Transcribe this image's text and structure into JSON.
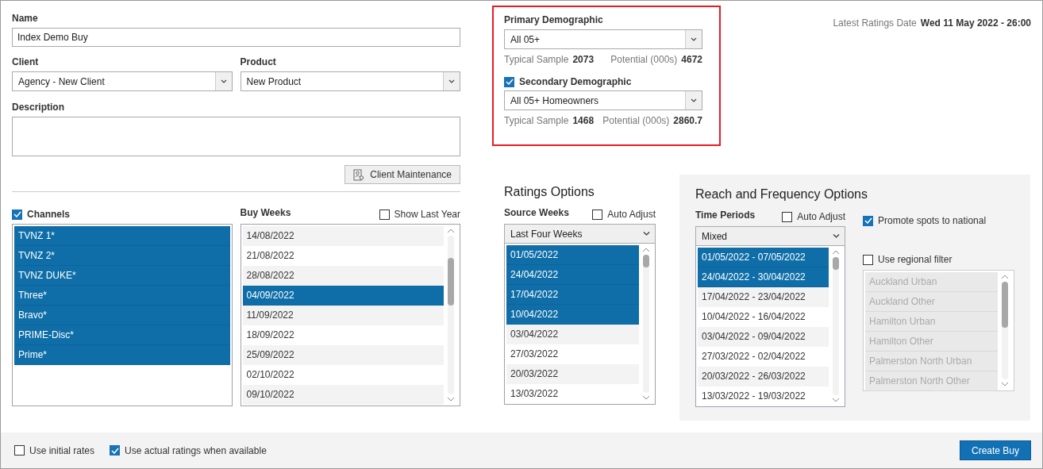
{
  "name": {
    "label": "Name",
    "value": "Index Demo Buy"
  },
  "client": {
    "label": "Client",
    "value": "Agency - New Client"
  },
  "product": {
    "label": "Product",
    "value": "New Product"
  },
  "description": {
    "label": "Description"
  },
  "client_maintenance_button": "Client Maintenance",
  "primary_demographic": {
    "label": "Primary Demographic",
    "value": "All 05+",
    "typical_sample_label": "Typical Sample",
    "typical_sample": "2073",
    "potential_label": "Potential (000s)",
    "potential": "4672"
  },
  "secondary_demographic": {
    "label": "Secondary Demographic",
    "checked": true,
    "value": "All 05+ Homeowners",
    "typical_sample_label": "Typical Sample",
    "typical_sample": "1468",
    "potential_label": "Potential (000s)",
    "potential": "2860.7"
  },
  "latest_ratings": {
    "label": "Latest Ratings Date",
    "value": "Wed 11 May 2022 - 26:00"
  },
  "channels": {
    "label": "Channels",
    "checked": true,
    "items": [
      {
        "label": "TVNZ 1*",
        "selected": true
      },
      {
        "label": "TVNZ 2*",
        "selected": true
      },
      {
        "label": "TVNZ DUKE*",
        "selected": true
      },
      {
        "label": "Three*",
        "selected": true
      },
      {
        "label": "Bravo*",
        "selected": true
      },
      {
        "label": "PRIME-Disc*",
        "selected": true
      },
      {
        "label": "Prime*",
        "selected": true
      }
    ]
  },
  "buy_weeks": {
    "label": "Buy Weeks",
    "show_last_year": {
      "label": "Show Last Year",
      "checked": false
    },
    "items": [
      {
        "label": "14/08/2022",
        "selected": false
      },
      {
        "label": "21/08/2022",
        "selected": false
      },
      {
        "label": "28/08/2022",
        "selected": false
      },
      {
        "label": "04/09/2022",
        "selected": true
      },
      {
        "label": "11/09/2022",
        "selected": false
      },
      {
        "label": "18/09/2022",
        "selected": false
      },
      {
        "label": "25/09/2022",
        "selected": false
      },
      {
        "label": "02/10/2022",
        "selected": false
      },
      {
        "label": "09/10/2022",
        "selected": false
      }
    ]
  },
  "ratings_options": {
    "title": "Ratings Options",
    "source_weeks_label": "Source Weeks",
    "auto_adjust": {
      "label": "Auto Adjust",
      "checked": false
    },
    "dropdown": "Last Four Weeks",
    "items": [
      {
        "label": "01/05/2022",
        "selected": true
      },
      {
        "label": "24/04/2022",
        "selected": true
      },
      {
        "label": "17/04/2022",
        "selected": true
      },
      {
        "label": "10/04/2022",
        "selected": true
      },
      {
        "label": "03/04/2022",
        "selected": false
      },
      {
        "label": "27/03/2022",
        "selected": false
      },
      {
        "label": "20/03/2022",
        "selected": false
      },
      {
        "label": "13/03/2022",
        "selected": false
      }
    ]
  },
  "reach_frequency": {
    "title": "Reach and Frequency Options",
    "time_periods_label": "Time Periods",
    "auto_adjust": {
      "label": "Auto Adjust",
      "checked": false
    },
    "dropdown": "Mixed",
    "items": [
      {
        "label": "01/05/2022 - 07/05/2022",
        "selected": true
      },
      {
        "label": "24/04/2022 - 30/04/2022",
        "selected": true
      },
      {
        "label": "17/04/2022 - 23/04/2022",
        "selected": false
      },
      {
        "label": "10/04/2022 - 16/04/2022",
        "selected": false
      },
      {
        "label": "03/04/2022 - 09/04/2022",
        "selected": false
      },
      {
        "label": "27/03/2022 - 02/04/2022",
        "selected": false
      },
      {
        "label": "20/03/2022 - 26/03/2022",
        "selected": false
      },
      {
        "label": "13/03/2022 - 19/03/2022",
        "selected": false
      }
    ],
    "promote_spots": {
      "label": "Promote spots to national",
      "checked": true
    },
    "regional_filter": {
      "label": "Use regional filter",
      "checked": false
    },
    "regions": [
      {
        "label": "Auckland Urban"
      },
      {
        "label": "Auckland Other"
      },
      {
        "label": "Hamilton Urban"
      },
      {
        "label": "Hamilton Other"
      },
      {
        "label": "Palmerston North Urban"
      },
      {
        "label": "Palmerston North Other"
      }
    ]
  },
  "footer": {
    "use_initial_rates": {
      "label": "Use initial rates",
      "checked": false
    },
    "use_actual_ratings": {
      "label": "Use actual ratings when available",
      "checked": true
    },
    "create_buy_button": "Create Buy"
  }
}
